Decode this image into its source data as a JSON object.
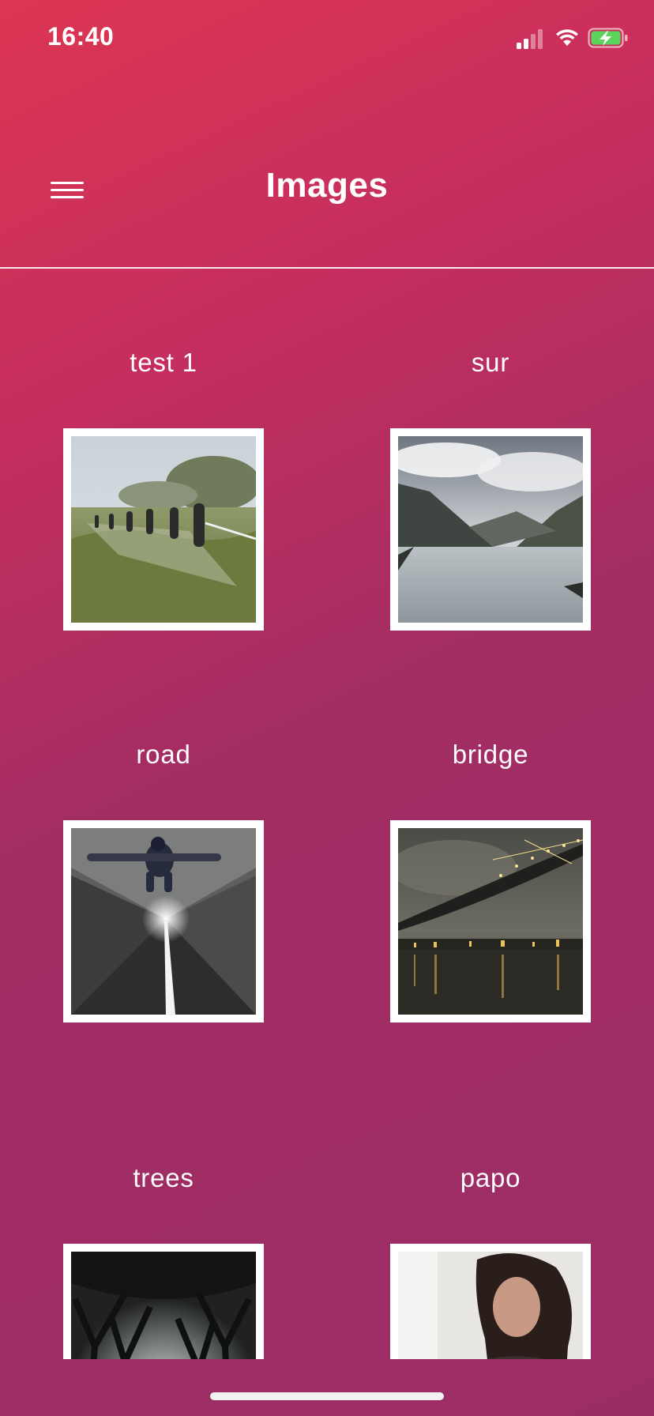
{
  "status_bar": {
    "time": "16:40",
    "icons": [
      "cellular-signal-icon",
      "wifi-icon",
      "battery-charging-icon"
    ],
    "battery_color": "#5bd45b"
  },
  "header": {
    "title": "Images",
    "menu_icon": "hamburger-menu-icon"
  },
  "gallery": {
    "items": [
      {
        "label": "test 1",
        "image": "photo-fishermen-net-field"
      },
      {
        "label": "sur",
        "image": "photo-fjord-mountains-lake"
      },
      {
        "label": "road",
        "image": "photo-tunnel-road-person"
      },
      {
        "label": "bridge",
        "image": "photo-night-bridge-city"
      },
      {
        "label": "trees",
        "image": "photo-misty-tree-avenue"
      },
      {
        "label": "papo",
        "image": "photo-man-with-motorcycle"
      }
    ]
  },
  "theme": {
    "gradient_start": "#dc3552",
    "gradient_end": "#9b2d66",
    "frame_color": "#ffffff"
  }
}
